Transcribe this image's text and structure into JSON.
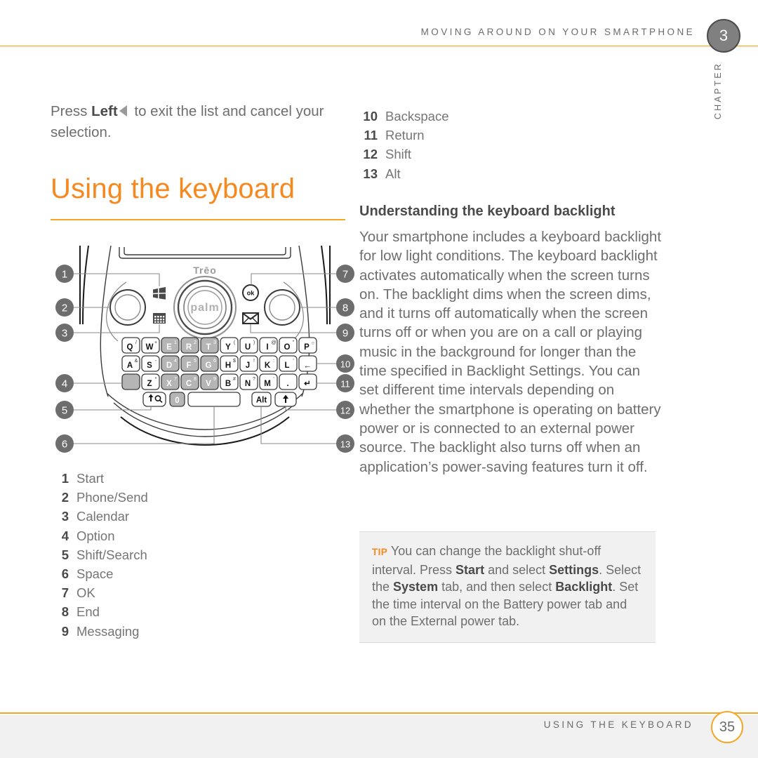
{
  "header": {
    "title": "MOVING AROUND ON YOUR SMARTPHONE",
    "chapter_number": "3",
    "chapter_word": "CHAPTER",
    "rule_color": "#f5a623"
  },
  "left": {
    "intro_before": "Press ",
    "intro_bold": "Left",
    "intro_icon": "triangle-left-icon",
    "intro_after": " to exit the list and cancel your selection.",
    "heading": "Using the keyboard",
    "heading_color": "#f5891f"
  },
  "figure": {
    "name": "treo-smartphone-keyboard-diagram",
    "brand_top": "Trēo",
    "brand_wheel": "palm",
    "ok_button": "ok",
    "icons": [
      "start-windows-icon",
      "calendar-grid-icon",
      "ok-icon",
      "envelope-icon"
    ],
    "callouts_left": [
      "1",
      "2",
      "3",
      "4",
      "5",
      "6"
    ],
    "callouts_right": [
      "7",
      "8",
      "9",
      "10",
      "11",
      "12",
      "13"
    ],
    "keyboard": {
      "row1": [
        {
          "key": "Q",
          "sup": "/"
        },
        {
          "key": "W",
          "sup": "+"
        },
        {
          "key": "E",
          "sup": "1",
          "num": true
        },
        {
          "key": "R",
          "sup": "2",
          "num": true
        },
        {
          "key": "T",
          "sup": "3",
          "num": true
        },
        {
          "key": "Y",
          "sup": "("
        },
        {
          "key": "U",
          "sup": ")"
        },
        {
          "key": "I",
          "sup": "@"
        },
        {
          "key": "O",
          "sup": "\""
        },
        {
          "key": "P",
          "sup": "☼"
        }
      ],
      "row2": [
        {
          "key": "A",
          "sup": "&"
        },
        {
          "key": "S",
          "sup": "-"
        },
        {
          "key": "D",
          "sup": "4",
          "num": true
        },
        {
          "key": "F",
          "sup": "5",
          "num": true
        },
        {
          "key": "G",
          "sup": "6",
          "num": true
        },
        {
          "key": "H",
          "sup": "$"
        },
        {
          "key": "J",
          "sup": "!"
        },
        {
          "key": "K",
          "sup": ":"
        },
        {
          "key": "L",
          "sup": "'"
        },
        {
          "key": "←",
          "sup": ""
        }
      ],
      "row3": [
        {
          "key": "",
          "sup": "",
          "option": true
        },
        {
          "key": "Z",
          "sup": "*"
        },
        {
          "key": "X",
          "sup": "7",
          "num": true
        },
        {
          "key": "C",
          "sup": "8",
          "num": true
        },
        {
          "key": "V",
          "sup": "9",
          "num": true
        },
        {
          "key": "B",
          "sup": "#"
        },
        {
          "key": "N",
          "sup": "?"
        },
        {
          "key": "M",
          "sup": "'"
        },
        {
          "key": ".",
          "sup": ""
        },
        {
          "key": "↵",
          "sup": ""
        }
      ],
      "row4": [
        {
          "key": "shift-search",
          "label": "⬆⌕"
        },
        {
          "key": "zero",
          "label": "0",
          "num": true
        },
        {
          "key": "space",
          "label": ""
        },
        {
          "key": "alt",
          "label": "Alt"
        },
        {
          "key": "shift",
          "label": "⬆"
        }
      ]
    }
  },
  "legend_left": [
    {
      "num": "1",
      "label": "Start"
    },
    {
      "num": "2",
      "label": "Phone/Send"
    },
    {
      "num": "3",
      "label": "Calendar"
    },
    {
      "num": "4",
      "label": "Option"
    },
    {
      "num": "5",
      "label": "Shift/Search"
    },
    {
      "num": "6",
      "label": "Space"
    },
    {
      "num": "7",
      "label": "OK"
    },
    {
      "num": "8",
      "label": "End"
    },
    {
      "num": "9",
      "label": "Messaging"
    }
  ],
  "legend_right": [
    {
      "num": "10",
      "label": "Backspace"
    },
    {
      "num": "11",
      "label": "Return"
    },
    {
      "num": "12",
      "label": "Shift"
    },
    {
      "num": "13",
      "label": "Alt"
    }
  ],
  "right": {
    "heading": "Understanding the keyboard backlight",
    "body": "Your smartphone includes a keyboard backlight for low light conditions. The keyboard backlight activates automatically when the screen turns on. The backlight dims when the screen dims, and it turns off automatically when the screen turns off or when you are on a call or playing music in the background for longer than the time specified in Backlight Settings. You can set different time intervals depending on whether the smartphone is operating on battery power or is connected to an external power source. The backlight also turns off when an application’s power-saving features turn it off."
  },
  "tip": {
    "label": "TIP",
    "t1": "You can change the backlight shut-off interval. Press ",
    "b1": "Start",
    "t2": " and select ",
    "b2": "Settings",
    "t3": ". Select the ",
    "b3": "System",
    "t4": " tab, and then select ",
    "b4": "Backlight",
    "t5": ". Set the time interval on the Battery power tab and on the External power tab."
  },
  "footer": {
    "title": "USING THE KEYBOARD",
    "page_number": "35",
    "rule_color": "#f5a623"
  }
}
